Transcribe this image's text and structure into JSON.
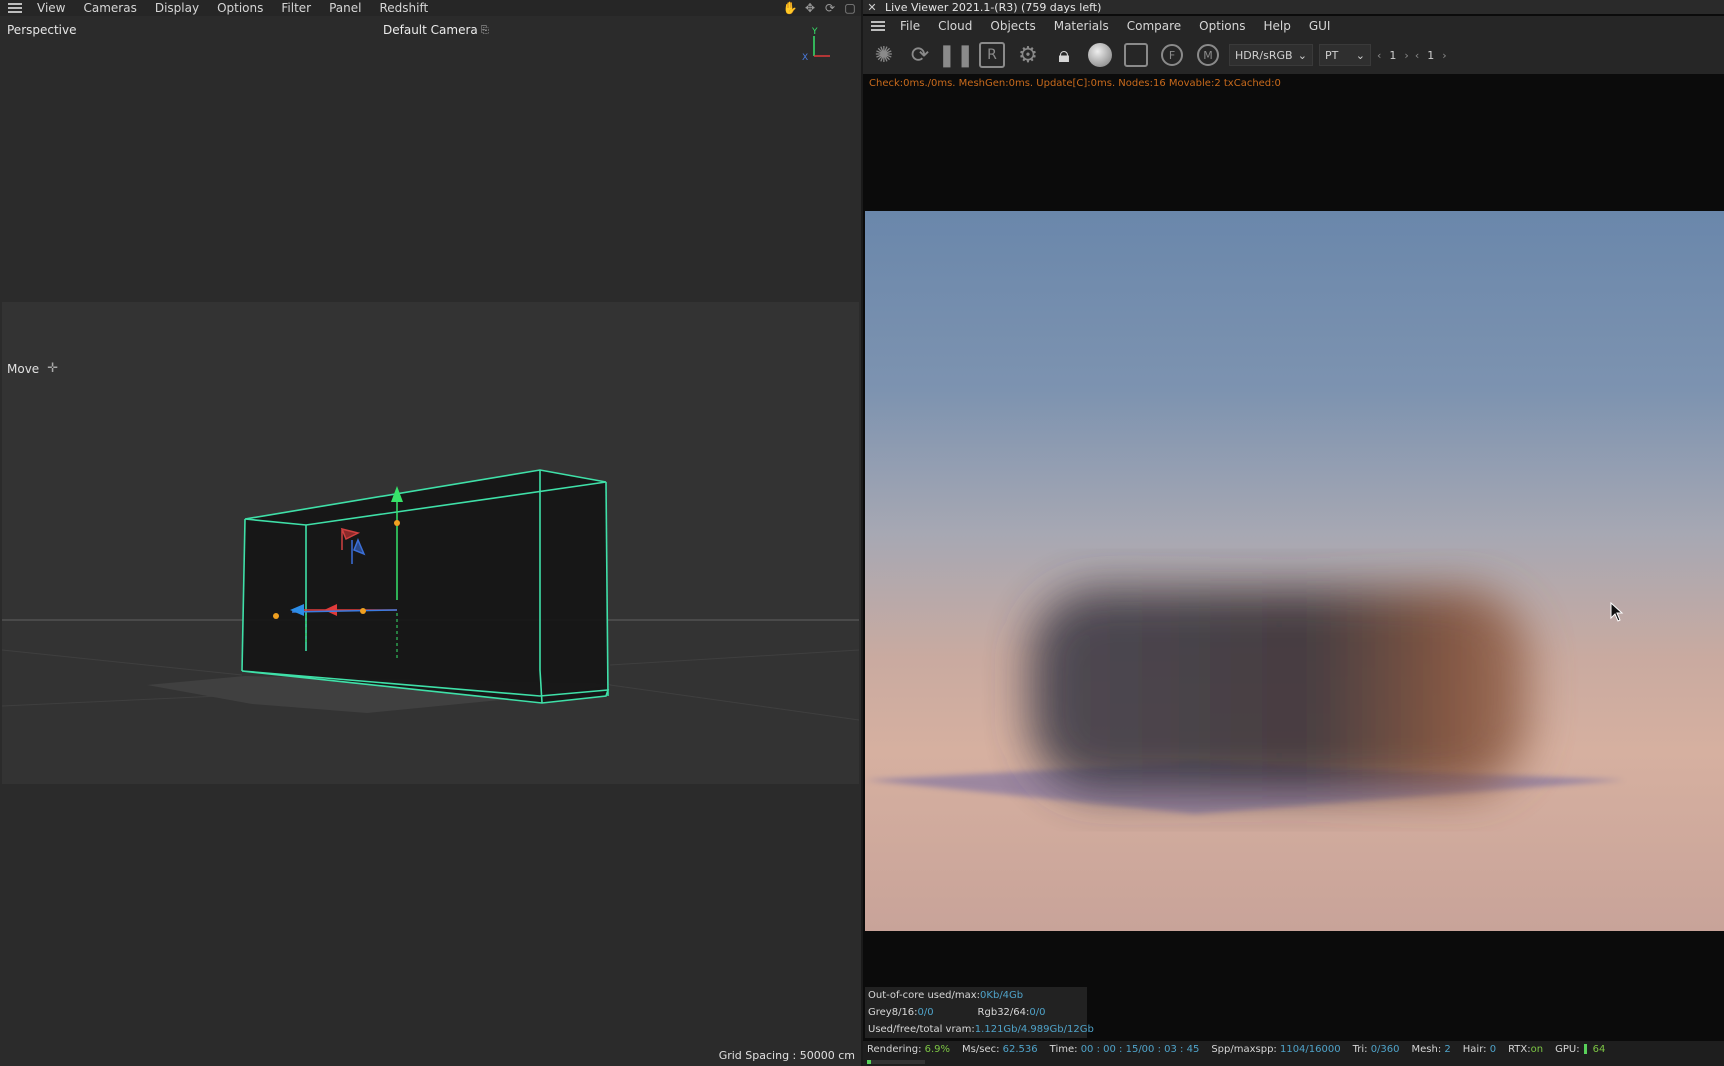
{
  "left": {
    "menu": [
      "View",
      "Cameras",
      "Display",
      "Options",
      "Filter",
      "Panel",
      "Redshift"
    ],
    "nav_icons": [
      "hand-pan-icon",
      "move-arrows-icon",
      "rotate-icon",
      "maximize-icon"
    ],
    "viewport": {
      "name": "Perspective",
      "camera": "Default Camera",
      "axis_labels": {
        "y": "Y",
        "x": "X"
      },
      "tool": "Move",
      "grid_spacing": "Grid Spacing : 50000 cm"
    }
  },
  "right": {
    "title": "Live Viewer 2021.1-(R3) (759 days left)",
    "menu": [
      "File",
      "Cloud",
      "Objects",
      "Materials",
      "Compare",
      "Options",
      "Help",
      "GUI"
    ],
    "toolbar": {
      "icons": [
        "render-settings-icon",
        "refresh-icon",
        "pause-icon",
        "r-region-icon",
        "settings-gear-icon",
        "lock-icon",
        "material-sphere-icon",
        "region-icon",
        "f-pin-icon",
        "m-pin-icon"
      ],
      "color_mode": "HDR/sRGB",
      "kernel": "PT",
      "counter1": "1",
      "counter2": "1"
    },
    "stats_line": "Check:0ms./0ms. MeshGen:0ms. Update[C]:0ms. Nodes:16 Movable:2 txCached:0",
    "info": {
      "ooc_label": "Out-of-core used/max:",
      "ooc_value": "0Kb/4Gb",
      "grey_label": "Grey8/16: ",
      "grey_value": "0/0",
      "rgb_label": "Rgb32/64: ",
      "rgb_value": "0/0",
      "vram_label": "Used/free/total vram: ",
      "vram_value": "1.121Gb/4.989Gb/12Gb"
    },
    "status": {
      "rendering_label": "Rendering: ",
      "rendering_value": "6.9%",
      "ms_label": "Ms/sec: ",
      "ms_value": "62.536",
      "time_label": "Time: ",
      "time_value": "00 : 00 : 15/00 : 03 : 45",
      "spp_label": "Spp/maxspp: ",
      "spp_value": "1104/16000",
      "tri_label": "Tri: ",
      "tri_value": "0/360",
      "mesh_label": "Mesh: ",
      "mesh_value": "2",
      "hair_label": "Hair: ",
      "hair_value": "0",
      "rtx_label": "RTX:",
      "rtx_value": "on",
      "gpu_label": "GPU:",
      "gpu_value": "64",
      "progress": 0.069
    }
  },
  "colors": {
    "accent_green": "#59d15a",
    "info_blue": "#4fa3c9",
    "stats_orange": "#c86a1c",
    "selection_cyan": "#3fe0a8"
  }
}
